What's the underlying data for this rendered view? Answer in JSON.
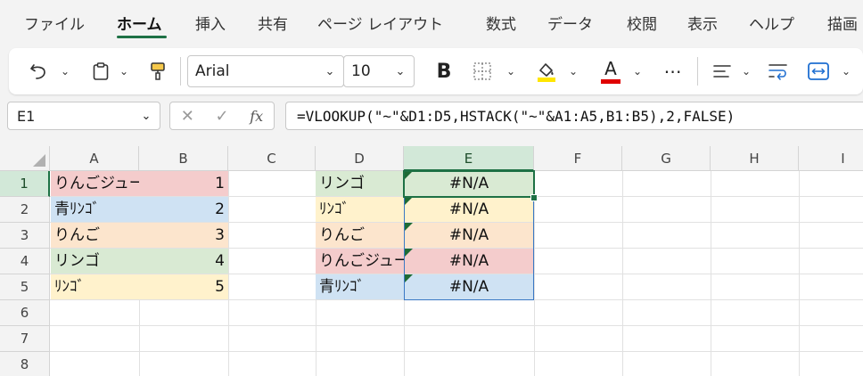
{
  "ribbon": {
    "tabs": [
      "ファイル",
      "ホーム",
      "挿入",
      "共有",
      "ページ レイアウト",
      "数式",
      "データ",
      "校閲",
      "表示",
      "ヘルプ",
      "描画"
    ]
  },
  "toolbar": {
    "font_name": "Arial",
    "font_size": "10",
    "bold_label": "B",
    "font_color_label": "A",
    "highlight_color": "#ffe600",
    "font_color": "#e00000"
  },
  "formula_bar": {
    "name_box": "E1",
    "fx_label": "fx",
    "formula": "=VLOOKUP(\"~\"&D1:D5,HSTACK(\"~\"&A1:A5,B1:B5),2,FALSE)"
  },
  "sheet": {
    "columns": [
      "A",
      "B",
      "C",
      "D",
      "E",
      "F",
      "G",
      "H",
      "I"
    ],
    "selected_column": "E",
    "rows": [
      "1",
      "2",
      "3",
      "4",
      "5",
      "6",
      "7",
      "8"
    ],
    "selected_row": "1",
    "col_a": [
      "りんごジュース",
      "青ﾘﾝｺﾞ",
      "りんご",
      "リンゴ",
      "ﾘﾝｺﾞ"
    ],
    "col_b": [
      "1",
      "2",
      "3",
      "4",
      "5"
    ],
    "col_d": [
      "リンゴ",
      "ﾘﾝｺﾞ",
      "りんご",
      "りんごジュース",
      "青ﾘﾝｺﾞ"
    ],
    "col_e": [
      "#N/A",
      "#N/A",
      "#N/A",
      "#N/A",
      "#N/A"
    ],
    "ab_colors": [
      "#f4cccc",
      "#cfe2f3",
      "#fce5cd",
      "#d9ead3",
      "#fff2cc"
    ],
    "de_colors": [
      "#d9ead3",
      "#fff2cc",
      "#fce5cd",
      "#f4cccc",
      "#cfe2f3"
    ],
    "accent": "#1e7145"
  }
}
